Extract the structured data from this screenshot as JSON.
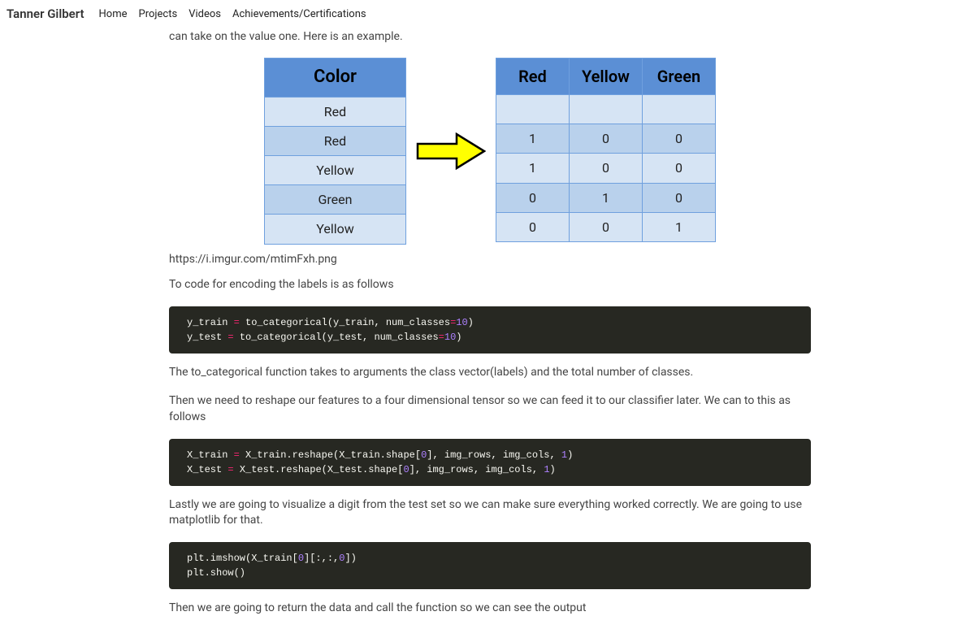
{
  "nav": {
    "brand": "Tanner Gilbert",
    "links": [
      "Home",
      "Projects",
      "Videos",
      "Achievements/Certifications"
    ]
  },
  "intro_line": "works better with classification and regression algorithms. It generates a boolean column for each category. Only one column can take on the value one. Here is an example.",
  "figure": {
    "left": {
      "header": "Color",
      "rows": [
        "Red",
        "Red",
        "Yellow",
        "Green",
        "Yellow"
      ]
    },
    "right": {
      "headers": [
        "Red",
        "Yellow",
        "Green"
      ],
      "rows": [
        [
          "1",
          "0",
          "0"
        ],
        [
          "1",
          "0",
          "0"
        ],
        [
          "0",
          "1",
          "0"
        ],
        [
          "0",
          "0",
          "1"
        ]
      ]
    },
    "caption_url": "https://i.imgur.com/mtimFxh.png"
  },
  "para_code_intro": "To code for encoding the labels is as follows",
  "code1": {
    "l1_a": "y_train ",
    "l1_op": "=",
    "l1_b": " to_categorical(y_train, num_classes",
    "l1_op2": "=",
    "l1_num": "10",
    "l1_c": ")",
    "l2_a": "y_test ",
    "l2_op": "=",
    "l2_b": " to_categorical(y_test, num_classes",
    "l2_op2": "=",
    "l2_num": "10",
    "l2_c": ")"
  },
  "para_after_code1": "The to_categorical function takes to arguments the class vector(labels) and the total number of classes.",
  "para_reshape": "Then we need to reshape our features to a four dimensional tensor so we can feed it to our classifier later. We can to this as follows",
  "code2": {
    "l1_a": "X_train ",
    "l1_op": "=",
    "l1_b": " X_train.reshape(X_train.shape[",
    "l1_n0": "0",
    "l1_c": "], img_rows, img_cols, ",
    "l1_n1": "1",
    "l1_d": ")",
    "l2_a": "X_test ",
    "l2_op": "=",
    "l2_b": " X_test.reshape(X_test.shape[",
    "l2_n0": "0",
    "l2_c": "], img_rows, img_cols, ",
    "l2_n1": "1",
    "l2_d": ")"
  },
  "para_visualize": "Lastly we are going to visualize a digit from the test set so we can make sure everything worked correctly. We are going to use matplotlib for that.",
  "code3": {
    "l1_a": "plt.imshow(X_train[",
    "l1_n0": "0",
    "l1_b": "][:,:,",
    "l1_n1": "0",
    "l1_c": "])",
    "l2": "plt.show()"
  },
  "para_return": "Then we are going to return the data and call the function so we can see the output"
}
